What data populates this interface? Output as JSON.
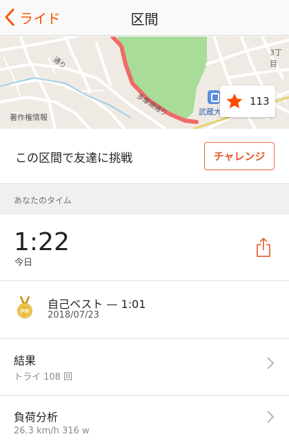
{
  "nav": {
    "back_label": "ライド",
    "title": "区間"
  },
  "map": {
    "credit": "著作権情報",
    "station_label": "武蔵大",
    "area_label": "3丁目",
    "road_label": "多摩湖通り",
    "small_road_label": "通り",
    "star_count": "113"
  },
  "challenge": {
    "text": "この区間で友達に挑戦",
    "button_label": "チャレンジ"
  },
  "your_time": {
    "header": "あなたのタイム",
    "time": "1:22",
    "date": "今日"
  },
  "personal_best": {
    "badge": "PR",
    "title": "自己ベスト — 1:01",
    "date": "2018/07/23"
  },
  "results": {
    "title": "結果",
    "subtitle": "トライ 108 回"
  },
  "load": {
    "title": "負荷分析",
    "subtitle": "26.3 km/h 316 w"
  },
  "colors": {
    "accent": "#fc5200",
    "route": "#f06a6a",
    "park": "#a8dc98",
    "star": "#fc4c02",
    "medal": "#e8b93a"
  },
  "icons": [
    "chevron-left-icon",
    "train-station-icon",
    "star-icon",
    "share-icon",
    "pr-medal-icon",
    "chevron-right-icon"
  ]
}
